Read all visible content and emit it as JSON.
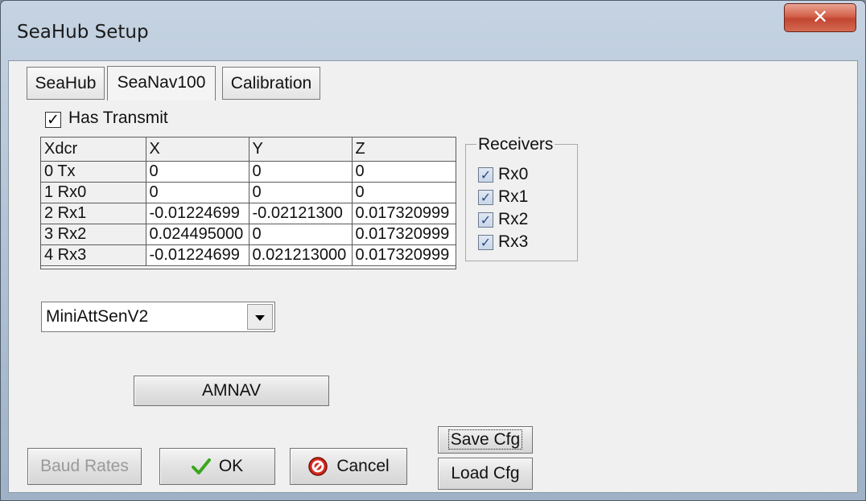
{
  "window": {
    "title": "SeaHub Setup",
    "close_icon": "close-icon"
  },
  "tabs": [
    {
      "label": "SeaHub",
      "active": false
    },
    {
      "label": "SeaNav100",
      "active": true
    },
    {
      "label": "Calibration",
      "active": false
    }
  ],
  "has_transmit": {
    "label": "Has Transmit",
    "checked": true
  },
  "grid": {
    "columns": [
      "Xdcr",
      "X",
      "Y",
      "Z"
    ],
    "rows": [
      [
        "0 Tx",
        "0",
        "0",
        "0"
      ],
      [
        "1 Rx0",
        "0",
        "0",
        "0"
      ],
      [
        "2 Rx1",
        "-0.01224699",
        "-0.02121300",
        "0.017320999"
      ],
      [
        "3 Rx2",
        "0.024495000",
        "0",
        "0.017320999"
      ],
      [
        "4 Rx3",
        "-0.01224699",
        "0.021213000",
        "0.017320999"
      ]
    ]
  },
  "receivers": {
    "title": "Receivers",
    "items": [
      {
        "label": "Rx0",
        "checked": true
      },
      {
        "label": "Rx1",
        "checked": true
      },
      {
        "label": "Rx2",
        "checked": true
      },
      {
        "label": "Rx3",
        "checked": true
      }
    ]
  },
  "sensor_select": {
    "value": "MiniAttSenV2"
  },
  "buttons": {
    "amnav": "AMNAV",
    "baud_rates": "Baud Rates",
    "ok": "OK",
    "cancel": "Cancel",
    "save_cfg": "Save Cfg",
    "load_cfg": "Load Cfg"
  },
  "icons": {
    "ok": "checkmark-icon",
    "cancel": "cancel-icon",
    "dropdown": "chevron-down-icon"
  },
  "colors": {
    "ok_check": "#3aa61c",
    "cancel_icon": "#d42a1e",
    "close_button": "#c9503a"
  }
}
